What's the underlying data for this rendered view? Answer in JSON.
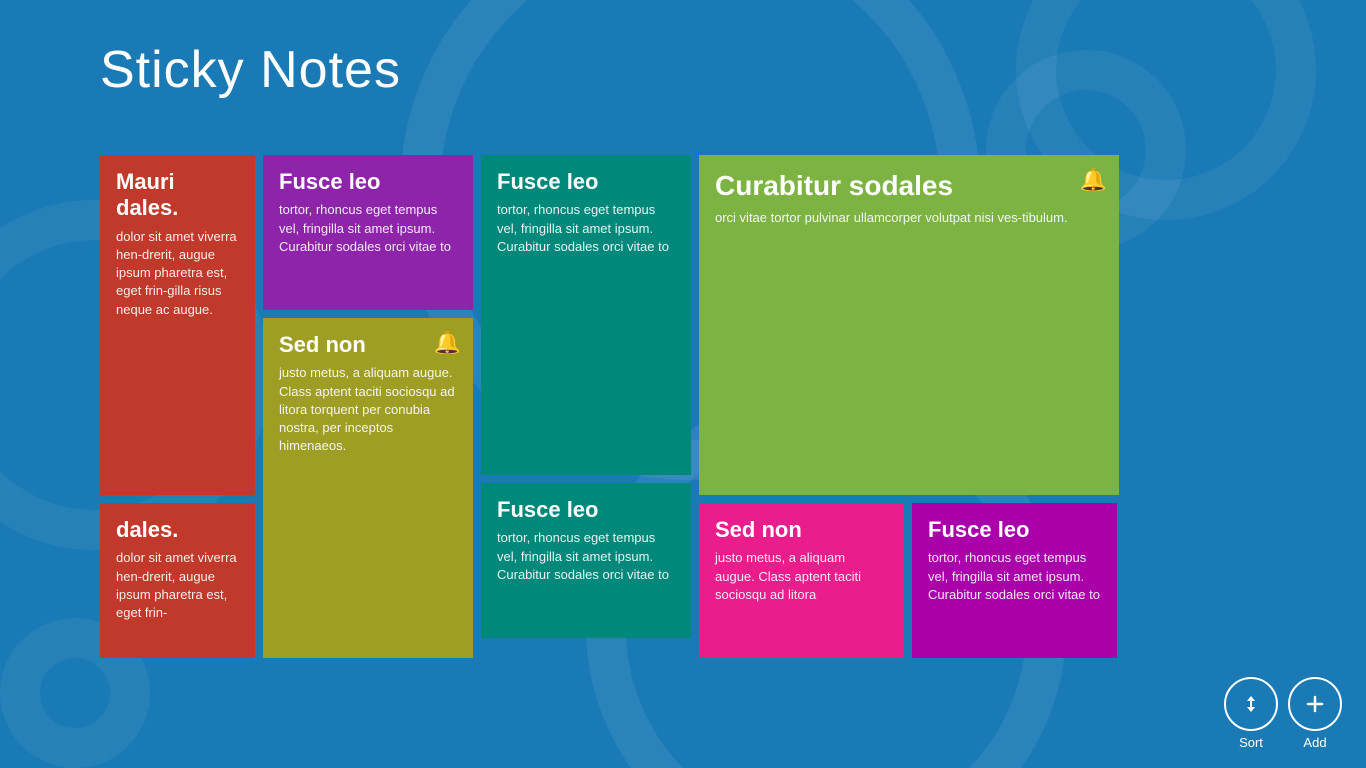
{
  "app": {
    "title": "Sticky Notes"
  },
  "notes": [
    {
      "id": "note-1",
      "title": "Mauri dales.",
      "body": "dolor sit amet viverra hen-drerit, augue ipsum pharetra est, eget frin-gilla risus neque ac augue.",
      "color": "red",
      "col": 1,
      "size": "top",
      "bell": false
    },
    {
      "id": "note-2",
      "title": "dales.",
      "body": "dolor sit amet viverra hen-drerit, augue ipsum pharetra est, eget frin-",
      "color": "red",
      "col": 1,
      "size": "bot",
      "bell": false
    },
    {
      "id": "note-3",
      "title": "Fusce leo",
      "body": "tortor, rhoncus eget tempus vel, fringilla sit amet ipsum. Curabitur sodales orci vitae to",
      "color": "purple",
      "col": 2,
      "size": "top",
      "bell": false
    },
    {
      "id": "note-4",
      "title": "Sed non",
      "body": "justo metus, a aliquam augue. Class aptent taciti sociosqu ad litora torquent per conubia nostra, per inceptos himenaeos.",
      "color": "olive",
      "col": 2,
      "size": "bot",
      "bell": true
    },
    {
      "id": "note-5",
      "title": "Fusce leo",
      "body": "tortor, rhoncus eget tempus vel, fringilla sit amet ipsum. Curabitur sodales orci vitae to",
      "color": "teal",
      "col": 3,
      "size": "top",
      "bell": false
    },
    {
      "id": "note-6",
      "title": "Fusce leo",
      "body": "tortor, rhoncus eget tempus vel, fringilla sit amet ipsum. Curabitur sodales orci vitae to",
      "color": "teal",
      "col": 3,
      "size": "bot",
      "bell": false
    },
    {
      "id": "note-7",
      "title": "Curabitur sodales",
      "body": "orci vitae tortor pulvinar ullamcorper volutpat nisi ves-tibulum.",
      "color": "green",
      "col": 4,
      "size": "big",
      "bell": true
    },
    {
      "id": "note-8",
      "title": "Sed non",
      "body": "justo metus, a aliquam augue. Class aptent taciti sociosqu ad litora",
      "color": "pink",
      "col": 4,
      "size": "left",
      "bell": false
    },
    {
      "id": "note-9",
      "title": "Fusce leo",
      "body": "tortor, rhoncus eget tempus vel, fringilla sit amet ipsum. Curabitur sodales orci vitae to",
      "color": "magenta",
      "col": 4,
      "size": "right",
      "bell": false
    }
  ],
  "toolbar": {
    "sort_label": "Sort",
    "add_label": "Add"
  }
}
